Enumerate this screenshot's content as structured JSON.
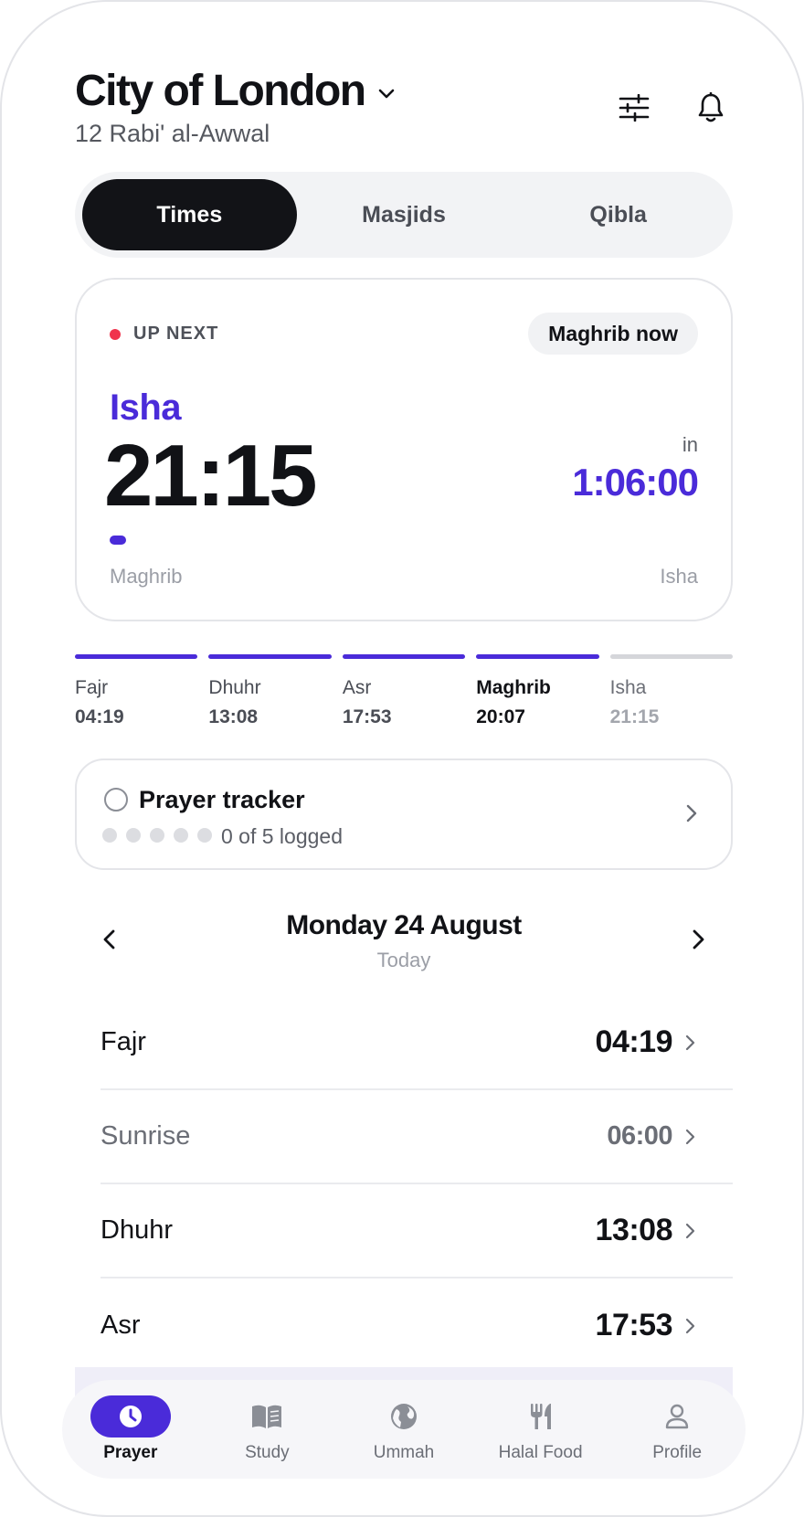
{
  "header": {
    "city": "City of London",
    "hijri_date": "12 Rabi' al-Awwal",
    "icons": [
      "filter-icon",
      "bell-icon"
    ]
  },
  "tabs": [
    {
      "label": "Times",
      "active": true
    },
    {
      "label": "Masjids",
      "active": false
    },
    {
      "label": "Qibla",
      "active": false
    }
  ],
  "next_card": {
    "status_label": "UP NEXT",
    "current_pill": "Maghrib now",
    "prayer": "Isha",
    "time": "21:15",
    "in_label": "in",
    "countdown": "1:06:00",
    "progress_from": "Maghrib",
    "progress_to": "Isha",
    "accent": "#4a2bd9",
    "dot_color": "#f0334d"
  },
  "timeline": [
    {
      "name": "Fajr",
      "time": "04:19",
      "state": "past"
    },
    {
      "name": "Dhuhr",
      "time": "13:08",
      "state": "past"
    },
    {
      "name": "Asr",
      "time": "17:53",
      "state": "past"
    },
    {
      "name": "Maghrib",
      "time": "20:07",
      "state": "current"
    },
    {
      "name": "Isha",
      "time": "21:15",
      "state": "future"
    }
  ],
  "tracker": {
    "title": "Prayer tracker",
    "logged_text": "0 of 5 logged",
    "logged": 0,
    "total": 5
  },
  "date_nav": {
    "date": "Monday 24 August",
    "sub": "Today"
  },
  "prayer_list": [
    {
      "name": "Fajr",
      "time": "04:19"
    },
    {
      "name": "Sunrise",
      "time": "06:00"
    },
    {
      "name": "Dhuhr",
      "time": "13:08"
    },
    {
      "name": "Asr",
      "time": "17:53"
    }
  ],
  "bottom_nav": [
    {
      "label": "Prayer",
      "icon": "clock-icon",
      "active": true
    },
    {
      "label": "Study",
      "icon": "book-icon",
      "active": false
    },
    {
      "label": "Ummah",
      "icon": "globe-icon",
      "active": false
    },
    {
      "label": "Halal Food",
      "icon": "utensils-icon",
      "active": false
    },
    {
      "label": "Profile",
      "icon": "person-icon",
      "active": false
    }
  ]
}
